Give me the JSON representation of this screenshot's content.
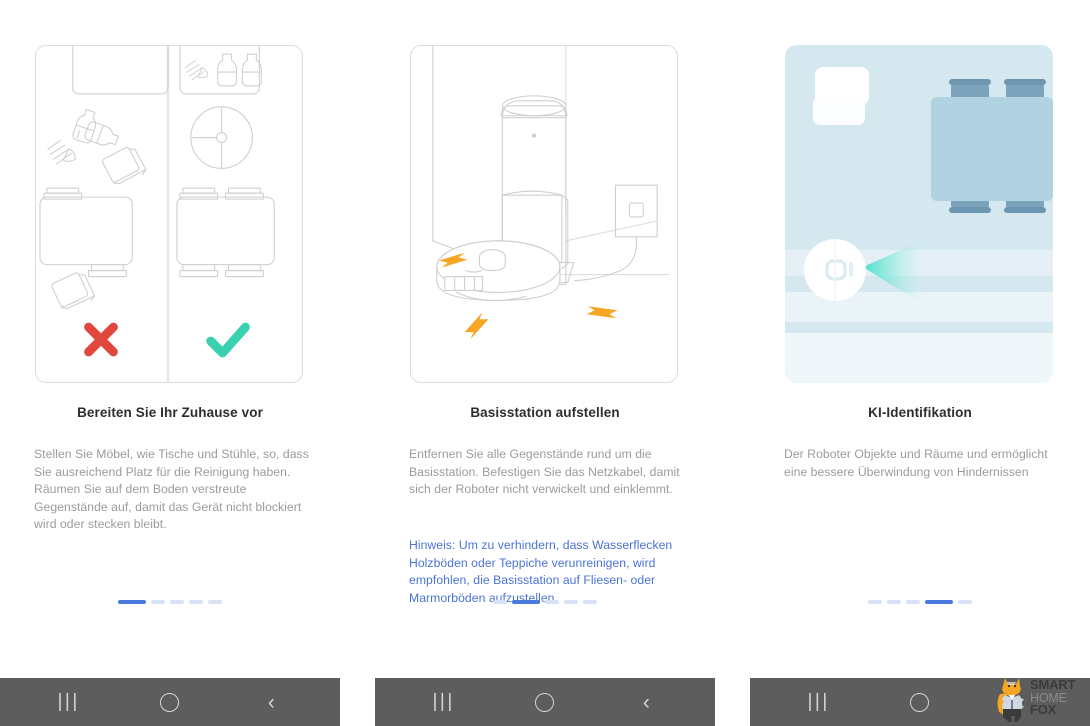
{
  "panels": [
    {
      "id": "prepare-home",
      "title": "Bereiten Sie Ihr Zuhause vor",
      "body": "Stellen Sie Möbel, wie Tische und Stühle, so, dass Sie ausreichend Platz für die Reinigung haben. Räumen Sie auf dem Boden verstreute Gegenstände auf, damit das Gerät nicht blockiert wird oder stecken bleibt.",
      "note": "",
      "illustration": "room-comparison-clutter-vs-tidy",
      "dots": {
        "count": 5,
        "active_index": 0
      }
    },
    {
      "id": "setup-base-station",
      "title": "Basisstation aufstellen",
      "body": "Entfernen Sie alle Gegenstände rund um die Basisstation. Befestigen Sie das Netzkabel, damit sich der Roboter nicht verwickelt und einklemmt.",
      "note": "Hinweis: Um zu verhindern, dass Wasserflecken Holzböden oder Teppiche verunreinigen, wird empfohlen, die Basisstation auf Fliesen- oder Marmorböden aufzustellen.",
      "illustration": "robot-docked-at-base-station",
      "dots": {
        "count": 5,
        "active_index": 1
      }
    },
    {
      "id": "ai-identification",
      "title": "KI-Identifikation",
      "body": "Der Roboter Objekte und Räume und ermöglicht eine bessere Überwindung von Hindernissen",
      "note": "",
      "illustration": "room-map-ai-scan",
      "dots": {
        "count": 5,
        "active_index": 3
      }
    }
  ],
  "navbar": {
    "recents_label": "|||",
    "home_label": "",
    "back_label": "‹"
  },
  "watermark": {
    "line1": "SMART",
    "line2": "HOME",
    "line3": "FOX"
  },
  "colors": {
    "accent_blue": "#4a79dd",
    "note_blue": "#4a73d6",
    "cross_red": "#e0483f",
    "check_teal": "#3ad1b0",
    "arrow_orange": "#f5a623",
    "line_gray": "#cfcfcf",
    "map_bg": "#d5e8f0",
    "map_furniture": "#b1d2e1",
    "map_chair": "#7ba3bb",
    "navbar_bg": "#5d5d5d"
  }
}
